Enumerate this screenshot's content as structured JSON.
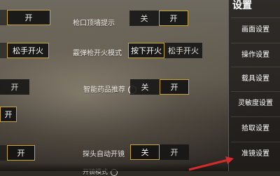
{
  "settings": {
    "rows": [
      {
        "label": "枪口顶墙提示",
        "options": [
          "关",
          "开"
        ],
        "selected": 1
      },
      {
        "label": "霰弹枪开火模式",
        "options": [
          "按下开火",
          "松手开火"
        ],
        "selected": 0
      },
      {
        "label": "智能药品推荐",
        "options": [
          "关",
          "开"
        ],
        "selected": 1,
        "help": "?"
      },
      {
        "label": "探头自动开镜",
        "options": [
          "关",
          "开"
        ],
        "selected": 0
      }
    ],
    "partial_label": "开镜模式",
    "left_column": {
      "row1_option": "开",
      "row2_option": "松手开火",
      "row3_option": "开",
      "row4_option": "开",
      "row5_option": "开"
    }
  },
  "sidebar": {
    "title": "设置",
    "items": [
      "画面设置",
      "操作设置",
      "载具设置",
      "灵敏度设置",
      "拾取设置",
      "准镜设置"
    ]
  },
  "colors": {
    "accent": "#c8a437",
    "arrow": "#d42b2b"
  }
}
